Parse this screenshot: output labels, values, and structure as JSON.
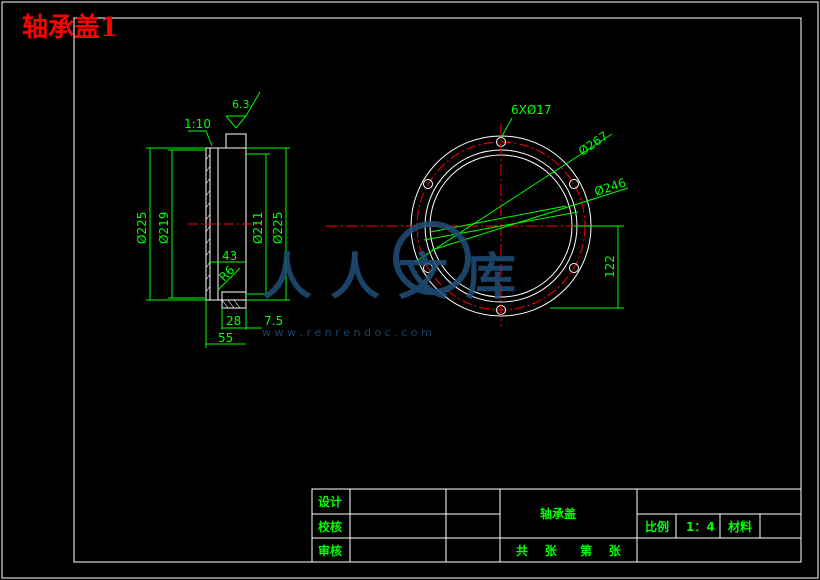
{
  "drawing_title": "轴承盖1",
  "colors": {
    "background": "#000000",
    "frame": "#ffffff",
    "dim": "#00ff00",
    "center": "#ff0000",
    "title": "#ff0000",
    "watermark": "#1f4f7a",
    "titleblock_text": "#00ff00"
  },
  "side_view": {
    "roughness": "6.3",
    "taper": "1:10",
    "dims": {
      "d225_left": "Ø225",
      "d219": "Ø219",
      "d211": "Ø211",
      "d225_right": "Ø225",
      "len43": "43",
      "radius": "R6",
      "w28": "28",
      "w7_5": "7.5",
      "w55": "55"
    }
  },
  "front_view": {
    "holes_label": "6XØ17",
    "d267": "Ø267",
    "d246": "Ø246",
    "h122": "122"
  },
  "watermark": {
    "text_cn": "人人文库",
    "url": "w w w . r e n r e n d o c . c o m"
  },
  "title_block": {
    "design": "设计",
    "check": "校核",
    "review": "审核",
    "part_name": "轴承盖",
    "scale_label": "比例",
    "scale_value": "1：4",
    "material_label": "材料",
    "total_sheets": "共    张",
    "sheet_no": "第    张"
  }
}
